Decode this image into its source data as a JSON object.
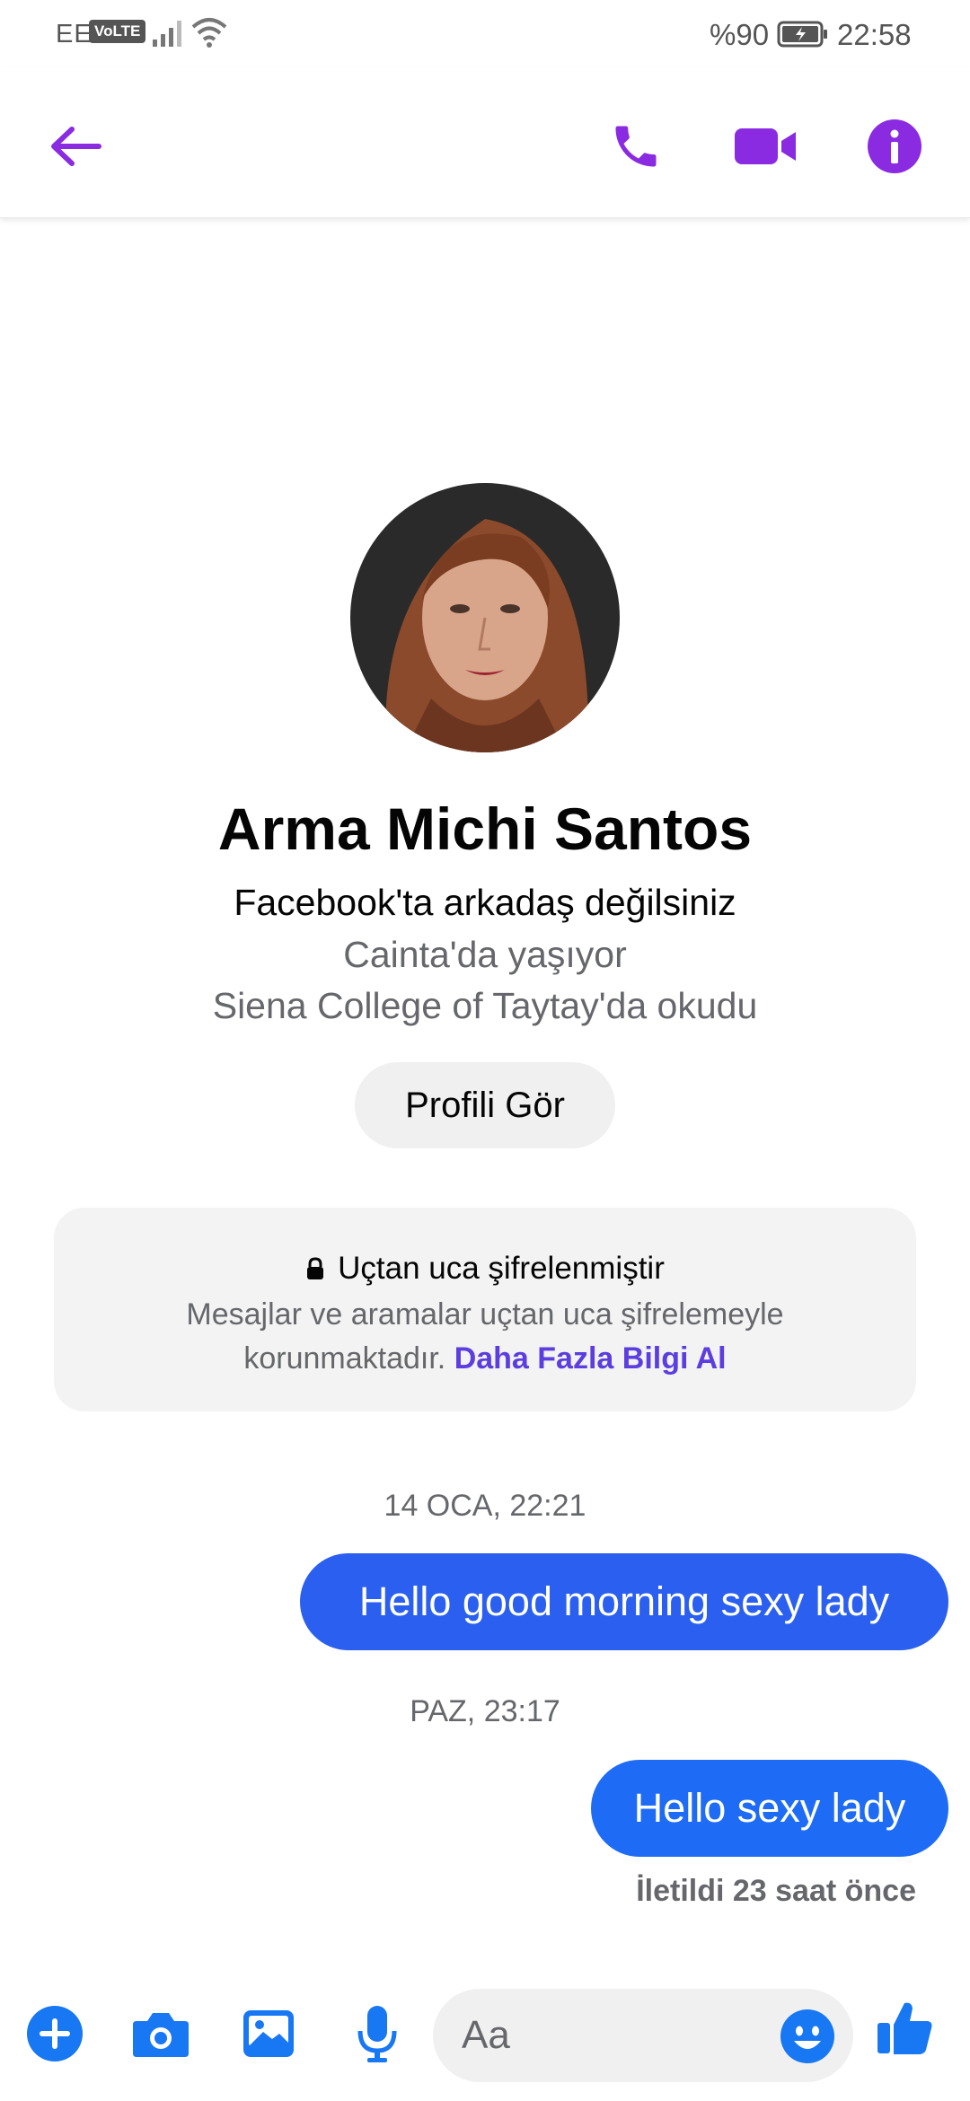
{
  "status_bar": {
    "carrier": "EE",
    "volte": "VoLTE",
    "battery": "%90",
    "time": "22:58"
  },
  "header": {
    "icons": [
      "back-arrow-icon",
      "phone-icon",
      "video-camera-icon",
      "info-icon"
    ]
  },
  "profile": {
    "name": "Arma Michi Santos",
    "friend_status": "Facebook'ta arkadaş değilsiniz",
    "lives_in": "Cainta'da yaşıyor",
    "studied_at": "Siena College of Taytay'da okudu",
    "view_profile_label": "Profili Gör"
  },
  "encryption": {
    "title": "Uçtan uca şifrelenmiştir",
    "body": "Mesajlar ve aramalar uçtan uca şifrelemeyle korunmaktadır.",
    "learn_more": "Daha Fazla Bilgi Al"
  },
  "messages": [
    {
      "timestamp": "14 OCA, 22:21",
      "text": "Hello good morning sexy lady"
    },
    {
      "timestamp": "PAZ, 23:17",
      "text": "Hello sexy lady"
    }
  ],
  "delivery_status": "İletildi 23 saat önce",
  "composer": {
    "placeholder": "Aa",
    "icons": [
      "plus-icon",
      "camera-icon",
      "gallery-icon",
      "microphone-icon",
      "emoji-icon",
      "thumbs-up-icon"
    ]
  },
  "colors": {
    "accent": "#8a2be2",
    "bubble": "#1e6cf5",
    "composer_icons": "#1877f2",
    "link": "#5b3de0"
  }
}
